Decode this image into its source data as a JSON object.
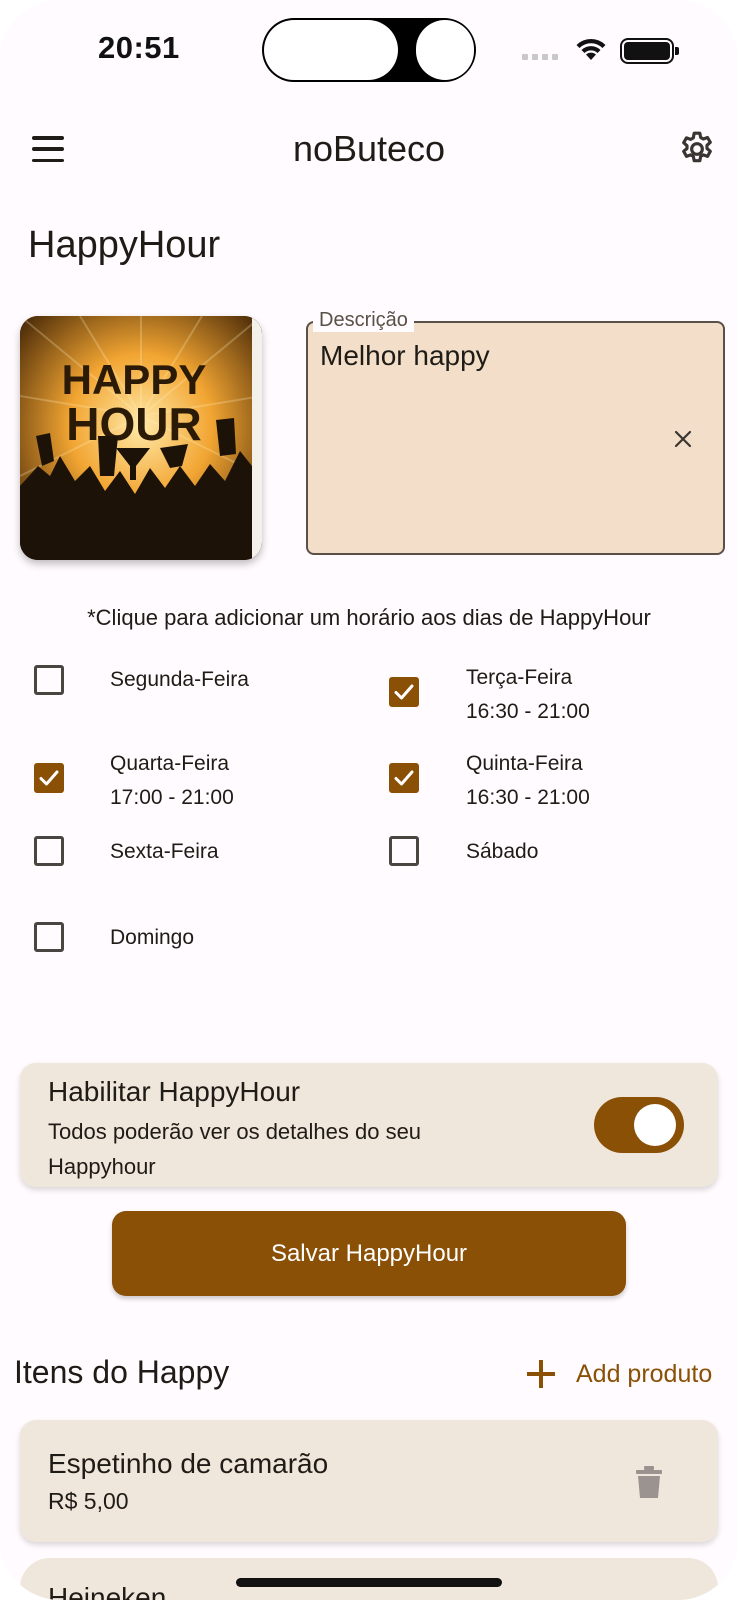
{
  "status_bar": {
    "time": "20:51"
  },
  "app_bar": {
    "title": "noButeco"
  },
  "page": {
    "title": "HappyHour"
  },
  "image": {
    "caption_lines": [
      "HAPPY",
      "HOUR"
    ]
  },
  "description": {
    "label": "Descrição",
    "value": "Melhor happy"
  },
  "hint": "*Clique para adicionar um horário aos dias de HappyHour",
  "days": [
    {
      "label": "Segunda-Feira",
      "checked": false,
      "time": ""
    },
    {
      "label": "Terça-Feira",
      "checked": true,
      "time": "16:30 - 21:00"
    },
    {
      "label": "Quarta-Feira",
      "checked": true,
      "time": "17:00 - 21:00"
    },
    {
      "label": "Quinta-Feira",
      "checked": true,
      "time": "16:30 - 21:00"
    },
    {
      "label": "Sexta-Feira",
      "checked": false,
      "time": ""
    },
    {
      "label": "Sábado",
      "checked": false,
      "time": ""
    },
    {
      "label": "Domingo",
      "checked": false,
      "time": ""
    }
  ],
  "enable": {
    "title": "Habilitar HappyHour",
    "subtitle": "Todos poderão ver os detalhes do seu Happyhour",
    "enabled": true
  },
  "save_button": "Salvar HappyHour",
  "items_section": {
    "title": "Itens do Happy",
    "add_label": "Add produto",
    "items": [
      {
        "name": "Espetinho de camarão",
        "price": "R$ 5,00"
      },
      {
        "name": "Heineken",
        "price": ""
      }
    ]
  },
  "colors": {
    "accent": "#8a5006",
    "field_bg": "#f3dfc9",
    "card_bg": "#f0e7dc"
  },
  "icons": [
    "menu-icon",
    "gear-icon",
    "close-icon",
    "check-icon",
    "plus-icon",
    "trash-icon"
  ]
}
